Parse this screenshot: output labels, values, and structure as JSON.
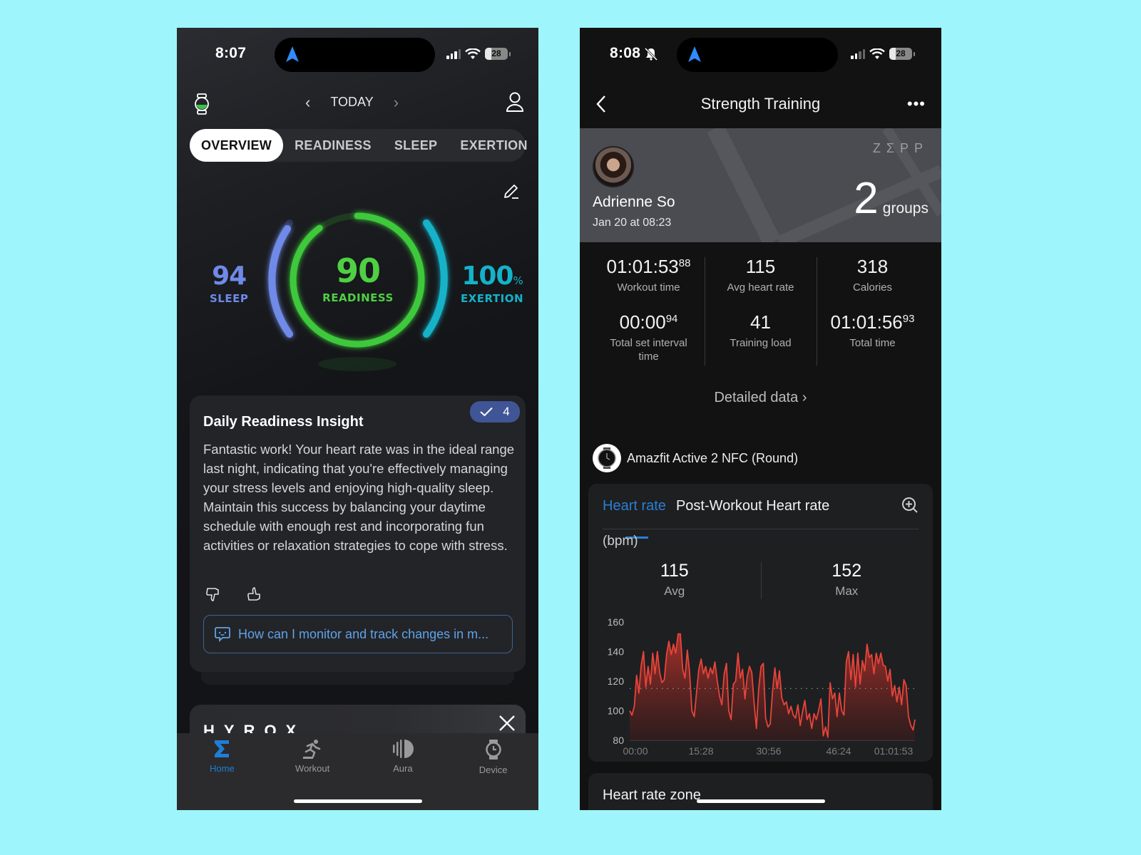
{
  "left_phone": {
    "status": {
      "time": "8:07",
      "battery": "28",
      "battery_fraction": 0.28
    },
    "topnav": {
      "date_label": "TODAY"
    },
    "tabs": [
      {
        "label": "OVERVIEW",
        "active": true
      },
      {
        "label": "READINESS",
        "active": false
      },
      {
        "label": "SLEEP",
        "active": false
      },
      {
        "label": "EXERTION",
        "active": false
      }
    ],
    "scores": {
      "sleep": {
        "value": "94",
        "label": "SLEEP",
        "color": "#6f8ae8"
      },
      "readiness": {
        "value": "90",
        "label": "READINESS",
        "color": "#4fd043"
      },
      "exertion": {
        "value": "100",
        "unit": "%",
        "label": "EXERTION",
        "color": "#13b3c8"
      }
    },
    "insight": {
      "title": "Daily Readiness Insight",
      "badge_count": "4",
      "body": "Fantastic work! Your heart rate was in the ideal range last night, indicating that you're effectively managing your stress levels and enjoying high-quality sleep. Maintain this success by balancing your daytime schedule with enough rest and incorporating fun activities or relaxation strategies to cope with stress.",
      "ask_prompt": "How can I monitor and track changes in m..."
    },
    "promo": {
      "logo": "HYROX"
    },
    "tabbar": [
      {
        "label": "Home",
        "icon": "sigma-icon",
        "active": true
      },
      {
        "label": "Workout",
        "icon": "running-icon",
        "active": false
      },
      {
        "label": "Aura",
        "icon": "aura-icon",
        "active": false
      },
      {
        "label": "Device",
        "icon": "watch-icon",
        "active": false
      }
    ],
    "accent": "#1d7fd8"
  },
  "right_phone": {
    "status": {
      "time": "8:08",
      "battery": "28",
      "battery_fraction": 0.28
    },
    "header": {
      "title": "Strength Training"
    },
    "banner": {
      "user_name": "Adrienne So",
      "date": "Jan 20 at 08:23",
      "brand": "ZΣPP",
      "groups_value": "2",
      "groups_unit": "groups"
    },
    "stats": [
      [
        {
          "value": "01:01:53",
          "sup": "88",
          "label": "Workout time"
        },
        {
          "value": "00:00",
          "sup": "94",
          "label": "Total set interval time"
        }
      ],
      [
        {
          "value": "115",
          "sup": "",
          "label": "Avg heart rate"
        },
        {
          "value": "41",
          "sup": "",
          "label": "Training load"
        }
      ],
      [
        {
          "value": "318",
          "sup": "",
          "label": "Calories"
        },
        {
          "value": "01:01:56",
          "sup": "93",
          "label": "Total time"
        }
      ]
    ],
    "detailed_link": "Detailed data",
    "device_name": "Amazfit Active 2 NFC (Round)",
    "hr_tabs": [
      {
        "label": "Heart rate",
        "active": true
      },
      {
        "label": "Post-Workout Heart rate",
        "active": false
      }
    ],
    "unit_label": "(bpm)",
    "hr_summary": [
      {
        "value": "115",
        "label": "Avg"
      },
      {
        "value": "152",
        "label": "Max"
      }
    ],
    "next_section": "Heart rate zone"
  },
  "chart_data": {
    "type": "area",
    "title": "Heart rate",
    "ylabel": "(bpm)",
    "xlabel": "",
    "ylim": [
      80,
      160
    ],
    "yticks": [
      160,
      140,
      120,
      100,
      80
    ],
    "xtick_labels": [
      "00:00",
      "15:28",
      "30:56",
      "46:24",
      "01:01:53"
    ],
    "xlim_minutes": [
      0,
      61.9
    ],
    "average_line": 115,
    "line_color": "#e8443a",
    "series": [
      {
        "name": "Heart rate (bpm)",
        "x_minutes": [
          0,
          0.5,
          1,
          1.5,
          2,
          2.5,
          3,
          3.5,
          4,
          4.5,
          5,
          5.5,
          6,
          6.5,
          7,
          7.5,
          8,
          8.5,
          9,
          9.5,
          10,
          10.5,
          11,
          11.5,
          12,
          12.5,
          13,
          13.5,
          14,
          14.5,
          15,
          15.5,
          16,
          16.5,
          17,
          17.5,
          18,
          18.5,
          19,
          19.5,
          20,
          20.5,
          21,
          21.5,
          22,
          22.5,
          23,
          23.5,
          24,
          24.5,
          25,
          25.5,
          26,
          26.5,
          27,
          27.5,
          28,
          28.5,
          29,
          29.5,
          30,
          30.5,
          31,
          31.5,
          32,
          32.5,
          33,
          33.5,
          34,
          34.5,
          35,
          35.5,
          36,
          36.5,
          37,
          37.5,
          38,
          38.5,
          39,
          39.5,
          40,
          40.5,
          41,
          41.5,
          42,
          42.5,
          43,
          43.5,
          44,
          44.5,
          45,
          45.5,
          46,
          46.5,
          47,
          47.5,
          48,
          48.5,
          49,
          49.5,
          50,
          50.5,
          51,
          51.5,
          52,
          52.5,
          53,
          53.5,
          54,
          54.5,
          55,
          55.5,
          56,
          56.5,
          57,
          57.5,
          58,
          58.5,
          59,
          59.5,
          60,
          60.5,
          61,
          61.5,
          61.9
        ],
        "values": [
          100,
          97,
          103,
          124,
          112,
          131,
          140,
          116,
          130,
          118,
          139,
          125,
          140,
          126,
          119,
          121,
          138,
          147,
          138,
          145,
          139,
          152,
          152,
          128,
          122,
          141,
          126,
          100,
          96,
          112,
          128,
          135,
          125,
          130,
          122,
          129,
          125,
          133,
          120,
          110,
          104,
          125,
          132,
          100,
          94,
          118,
          120,
          139,
          122,
          128,
          108,
          123,
          130,
          126,
          105,
          88,
          115,
          130,
          132,
          95,
          89,
          91,
          113,
          129,
          115,
          127,
          109,
          104,
          106,
          98,
          103,
          97,
          95,
          104,
          90,
          99,
          107,
          94,
          98,
          88,
          98,
          94,
          100,
          108,
          83,
          89,
          82,
          119,
          108,
          112,
          96,
          112,
          100,
          97,
          133,
          140,
          121,
          138,
          116,
          139,
          118,
          134,
          127,
          145,
          136,
          138,
          125,
          139,
          132,
          139,
          131,
          130,
          120,
          128,
          110,
          117,
          106,
          116,
          104,
          121,
          117,
          96,
          90,
          87,
          94,
          86,
          99,
          90,
          88,
          105,
          113
        ]
      }
    ],
    "grid": false,
    "legend": "none"
  }
}
